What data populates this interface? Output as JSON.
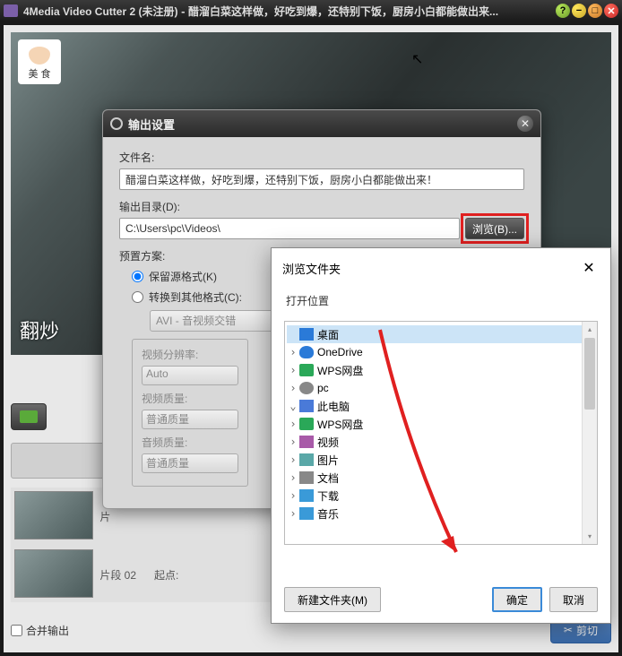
{
  "titlebar": {
    "app": "4Media Video Cutter 2 (未注册)",
    "doc": "醋溜白菜这样做，好吃到爆，还特别下饭，厨房小白都能做出来..."
  },
  "video": {
    "badge_label": "美 食",
    "subtitle_fragment": "翻炒"
  },
  "settings": {
    "title": "输出设置",
    "filename_label": "文件名:",
    "filename_value": "醋溜白菜这样做，好吃到爆，还特别下饭，厨房小白都能做出来！",
    "outdir_label": "输出目录(D):",
    "outdir_value": "C:\\Users\\pc\\Videos\\",
    "browse_btn": "浏览(B)...",
    "preset_label": "预置方案:",
    "keep_source": "保留源格式(K)",
    "convert_to": "转换到其他格式(C):",
    "format_value": "AVI - 音视频交错",
    "group": {
      "resolution_label": "视频分辨率:",
      "resolution_value": "Auto",
      "vq_label": "视频质量:",
      "vq_value": "普通质量",
      "aq_label": "音频质量:",
      "aq_value": "普通质量"
    }
  },
  "browse": {
    "title": "浏览文件夹",
    "subtitle": "打开位置",
    "tree": {
      "desktop": "桌面",
      "onedrive": "OneDrive",
      "wps": "WPS网盘",
      "pc_user": "pc",
      "this_pc": "此电脑",
      "wps2": "WPS网盘",
      "video": "视频",
      "pictures": "图片",
      "documents": "文档",
      "downloads": "下载",
      "music": "音乐"
    },
    "new_folder": "新建文件夹(M)",
    "ok": "确定",
    "cancel": "取消"
  },
  "clips": {
    "seg1_label": "片",
    "seg2_label": "片段 02",
    "start_label": "起点:"
  },
  "bottom": {
    "combine": "合并输出",
    "cut": "剪切"
  }
}
